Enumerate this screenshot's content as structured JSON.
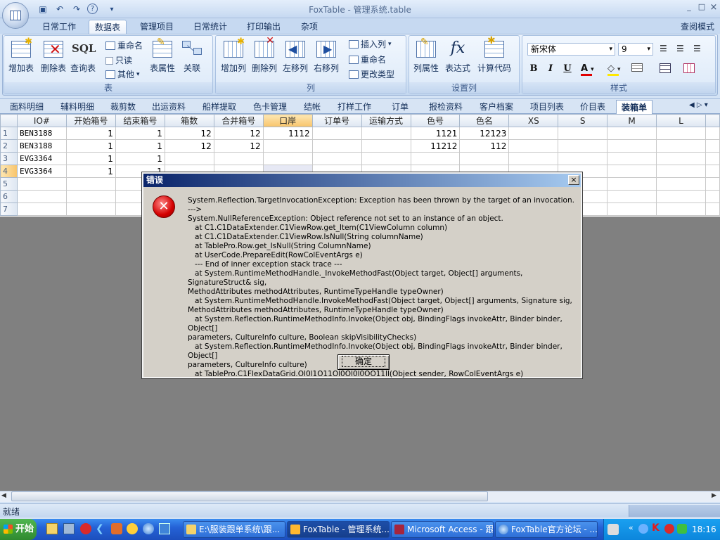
{
  "window": {
    "title": "FoxTable - 管理系统.table",
    "minimize": "_",
    "maximize": "□",
    "close": "×"
  },
  "ribbon": {
    "tabs": [
      "日常工作",
      "数据表",
      "管理项目",
      "日常统计",
      "打印输出",
      "杂项"
    ],
    "active_tab": "数据表",
    "view_mode": "查阅模式",
    "groups": {
      "table": {
        "label": "表",
        "add": "增加表",
        "delete": "删除表",
        "query": "查询表",
        "query_icon": "SQL",
        "rename": "重命名",
        "readonly": "只读",
        "other": "其他",
        "properties": "表属性",
        "relations": "关联"
      },
      "column": {
        "label": "列",
        "add": "增加列",
        "delete": "删除列",
        "move_left": "左移列",
        "move_right": "右移列",
        "insert": "插入列",
        "rename": "重命名",
        "change_type": "更改类型"
      },
      "settings": {
        "label": "设置列",
        "col_props": "列属性",
        "expression": "表达式",
        "expression_icon": "fx",
        "calc_code": "计算代码"
      },
      "style": {
        "label": "样式",
        "font": "新宋体",
        "size": "9",
        "bold": "B",
        "italic": "I",
        "underline": "U"
      }
    }
  },
  "sheet_tabs": [
    "面料明细",
    "辅料明细",
    "裁剪数",
    "出运资料",
    "船样提取",
    "色卡管理",
    "结帐",
    "打样工作",
    "订单",
    "报检资料",
    "客户档案",
    "项目列表",
    "价目表",
    "装箱单"
  ],
  "active_sheet": "装箱单",
  "grid": {
    "columns": [
      "IO#",
      "开始箱号",
      "结束箱号",
      "箱数",
      "合并箱号",
      "口岸",
      "订单号",
      "运输方式",
      "色号",
      "色名",
      "XS",
      "S",
      "M",
      "L"
    ],
    "highlight_column": "口岸",
    "rows": [
      {
        "n": "1",
        "cells": [
          "BEN3188",
          "1",
          "1",
          "12",
          "12",
          "1112",
          "",
          "",
          "1121",
          "12123",
          "",
          "",
          "",
          ""
        ]
      },
      {
        "n": "2",
        "cells": [
          "BEN3188",
          "1",
          "1",
          "12",
          "12",
          "",
          "",
          "",
          "11212",
          "112",
          "",
          "",
          "",
          ""
        ]
      },
      {
        "n": "3",
        "cells": [
          "EVG3364",
          "1",
          "1",
          "",
          "",
          "",
          "",
          "",
          "",
          "",
          "",
          "",
          "",
          ""
        ]
      },
      {
        "n": "4",
        "cells": [
          "EVG3364",
          "1",
          "1",
          "",
          "",
          "",
          "",
          "",
          "",
          "",
          "",
          "",
          "",
          ""
        ]
      },
      {
        "n": "5",
        "cells": [
          "",
          "",
          "",
          "",
          "",
          "",
          "",
          "",
          "",
          "",
          "",
          "",
          "",
          ""
        ]
      },
      {
        "n": "6",
        "cells": [
          "",
          "",
          "",
          "",
          "",
          "",
          "",
          "",
          "",
          "",
          "",
          "",
          "",
          ""
        ]
      },
      {
        "n": "7",
        "cells": [
          "",
          "",
          "",
          "",
          "",
          "",
          "",
          "",
          "",
          "",
          "",
          "",
          "",
          ""
        ]
      }
    ]
  },
  "status": {
    "text": "就绪"
  },
  "dialog": {
    "title": "错误",
    "close": "×",
    "message": "System.Reflection.TargetInvocationException: Exception has been thrown by the target of an invocation. --->\nSystem.NullReferenceException: Object reference not set to an instance of an object.\n   at C1.C1DataExtender.C1ViewRow.get_Item(C1ViewColumn column)\n   at C1.C1DataExtender.C1ViewRow.IsNull(String columnName)\n   at TablePro.Row.get_IsNull(String ColumnName)\n   at UserCode.PrepareEdit(RowColEventArgs e)\n   --- End of inner exception stack trace ---\n   at System.RuntimeMethodHandle._InvokeMethodFast(Object target, Object[] arguments, SignatureStruct& sig,\nMethodAttributes methodAttributes, RuntimeTypeHandle typeOwner)\n   at System.RuntimeMethodHandle.InvokeMethodFast(Object target, Object[] arguments, Signature sig,\nMethodAttributes methodAttributes, RuntimeTypeHandle typeOwner)\n   at System.Reflection.RuntimeMethodInfo.Invoke(Object obj, BindingFlags invokeAttr, Binder binder, Object[]\nparameters, CultureInfo culture, Boolean skipVisibilityChecks)\n   at System.Reflection.RuntimeMethodInfo.Invoke(Object obj, BindingFlags invokeAttr, Binder binder, Object[]\nparameters, CultureInfo culture)\n   at TablePro.C1FlexDataGrid.Ol0l1O11Ol0Ol0l0OO11ll(Object sender, RowColEventArgs e)",
    "ok": "确定"
  },
  "taskbar": {
    "start": "开始",
    "tasks": [
      "E:\\服装跟单系统\\跟...",
      "FoxTable - 管理系统...",
      "Microsoft Access - 跟...",
      "FoxTable官方论坛 - ..."
    ],
    "active_task": 1,
    "clock": "18:16"
  }
}
